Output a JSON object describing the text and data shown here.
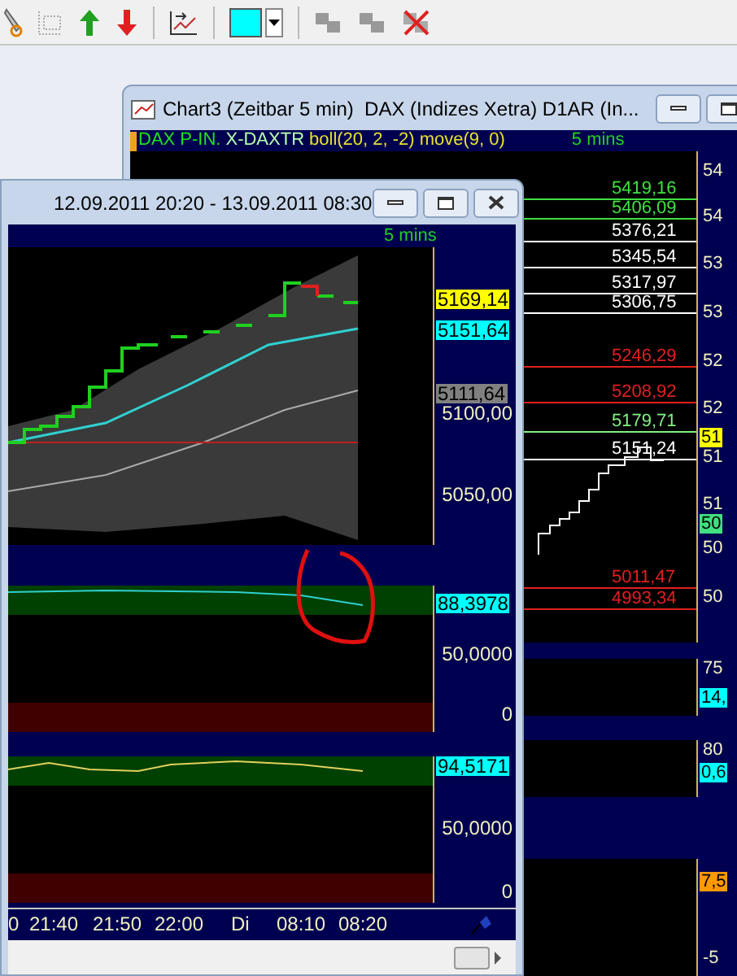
{
  "back_window": {
    "title": "Chart3 (Zeitbar 5 min)  DAX (Indizes Xetra) D1AR (In...",
    "legend": [
      {
        "text": "DAX P-IN.",
        "color": "#22e022"
      },
      {
        "text": "X-DAXTR",
        "color": "#b8ffb0"
      },
      {
        "text": "boll(20, 2, -2)",
        "color": "#e8e030"
      },
      {
        "text": "move(9, 0)",
        "color": "#e8e030"
      }
    ],
    "interval": "5 mins",
    "levels": [
      {
        "value": "5419,16",
        "color": "#40e040"
      },
      {
        "value": "5406,09",
        "color": "#40e040"
      },
      {
        "value": "5376,21",
        "color": "#ffffff"
      },
      {
        "value": "5345,54",
        "color": "#ffffff"
      },
      {
        "value": "5317,97",
        "color": "#ffffff"
      },
      {
        "value": "5306,75",
        "color": "#ffffff"
      },
      {
        "value": "5246,29",
        "color": "#e02020"
      },
      {
        "value": "5208,92",
        "color": "#e02020"
      },
      {
        "value": "5179,71",
        "color": "#80f080"
      },
      {
        "value": "5151,24",
        "color": "#ffffff"
      },
      {
        "value": "5011,47",
        "color": "#e02020"
      },
      {
        "value": "4993,34",
        "color": "#e02020"
      }
    ],
    "axis_labels": [
      {
        "text": "54",
        "kind": "plain"
      },
      {
        "text": "54",
        "kind": "plain"
      },
      {
        "text": "53",
        "kind": "plain"
      },
      {
        "text": "53",
        "kind": "plain"
      },
      {
        "text": "52",
        "kind": "plain"
      },
      {
        "text": "52",
        "kind": "plain"
      },
      {
        "text": "51",
        "kind": "marker",
        "color": "#ffff00"
      },
      {
        "text": "51",
        "kind": "plain"
      },
      {
        "text": "51",
        "kind": "plain"
      },
      {
        "text": "50",
        "kind": "marker",
        "color": "#40e080"
      },
      {
        "text": "50",
        "kind": "plain"
      },
      {
        "text": "50",
        "kind": "plain"
      }
    ],
    "lower_axis_labels": [
      {
        "text": "75",
        "kind": "plain"
      },
      {
        "text": "14,",
        "kind": "marker",
        "color": "#00ffff"
      },
      {
        "text": "80",
        "kind": "plain"
      },
      {
        "text": "0,6",
        "kind": "marker",
        "color": "#00ffff"
      },
      {
        "text": "7,5",
        "kind": "marker",
        "color": "#ff9900"
      },
      {
        "text": "-5",
        "kind": "plain"
      }
    ]
  },
  "front_window": {
    "title": "12.09.2011 20:20 - 13.09.2011 08:30",
    "interval": "5 mins",
    "price_labels": [
      {
        "text": "5169,14",
        "kind": "marker",
        "color": "#ffff00"
      },
      {
        "text": "5151,64",
        "kind": "marker",
        "color": "#00ffff"
      },
      {
        "text": "5111,64",
        "kind": "marker",
        "color": "#808080"
      },
      {
        "text": "5100,00",
        "kind": "plain"
      },
      {
        "text": "5050,00",
        "kind": "plain"
      }
    ],
    "panels": [
      {
        "labels": [
          {
            "text": "88,3978",
            "kind": "marker",
            "color": "#00ffff"
          },
          {
            "text": "50,0000",
            "kind": "plain"
          },
          {
            "text": "0",
            "kind": "plain"
          }
        ]
      },
      {
        "labels": [
          {
            "text": "94,5171",
            "kind": "marker",
            "color": "#00ffff"
          },
          {
            "text": "50,0000",
            "kind": "plain"
          },
          {
            "text": "0",
            "kind": "plain"
          }
        ]
      }
    ],
    "time_labels": [
      "0",
      "21:40",
      "21:50",
      "22:00",
      "Di",
      "08:10",
      "08:20"
    ]
  }
}
